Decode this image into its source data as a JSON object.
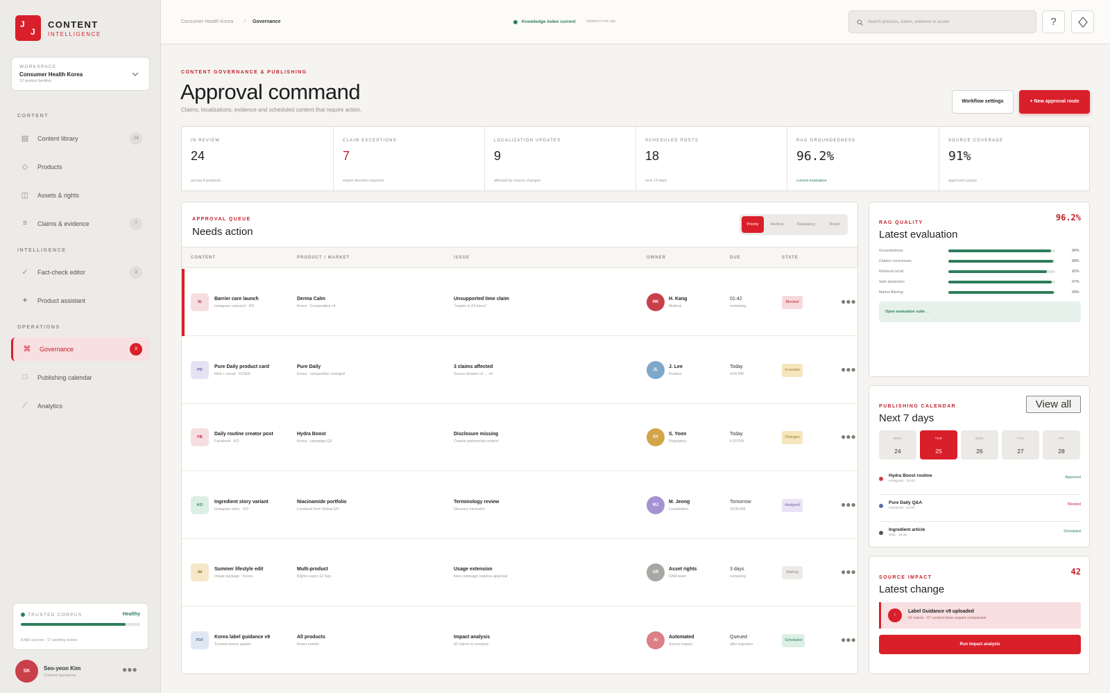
{
  "brand": {
    "logo_left": "J",
    "logo_right": "J",
    "name": "CONTENT",
    "subname": "INTELLIGENCE"
  },
  "workspace": {
    "caption": "WORKSPACE",
    "name": "Consumer Health Korea",
    "sub": "12 product families"
  },
  "sidebar": {
    "sections": [
      {
        "title": "CONTENT",
        "items": [
          {
            "label": "Content library",
            "icon": "library-icon",
            "count": "24"
          },
          {
            "label": "Products",
            "icon": "products-icon",
            "count": ""
          },
          {
            "label": "Assets & rights",
            "icon": "assets-icon",
            "count": ""
          },
          {
            "label": "Claims & evidence",
            "icon": "claims-icon",
            "count": "7"
          }
        ]
      },
      {
        "title": "INTELLIGENCE",
        "items": [
          {
            "label": "Fact-check editor",
            "icon": "check-icon",
            "count": "3"
          },
          {
            "label": "Product assistant",
            "icon": "sparkle-icon",
            "count": ""
          }
        ]
      },
      {
        "title": "OPERATIONS",
        "items": [
          {
            "label": "Governance",
            "icon": "command-icon",
            "count": "9",
            "active": true
          },
          {
            "label": "Publishing calendar",
            "icon": "calendar-icon",
            "count": ""
          },
          {
            "label": "Analytics",
            "icon": "analytics-icon",
            "count": ""
          }
        ]
      }
    ],
    "corpus": {
      "label": "TRUSTED CORPUS",
      "status": "Healthy",
      "progress": 0.88,
      "detail": "8,482 sources · 17 pending review"
    },
    "user": {
      "initials": "SK",
      "name": "Seo-yeon Kim",
      "role": "Content operations"
    }
  },
  "topbar": {
    "breadcrumb": [
      "Consumer Health Korea",
      "Governance"
    ],
    "status": "Knowledge index current",
    "updated": "Updated 4 min ago",
    "search_placeholder": "Search products, claims, evidence or assets"
  },
  "header": {
    "eyebrow": "CONTENT GOVERNANCE & PUBLISHING",
    "title": "Approval command",
    "subtitle": "Claims, localizations, evidence and scheduled content that require action.",
    "btn_settings": "Workflow settings",
    "btn_new": "+ New approval route"
  },
  "kpis": [
    {
      "label": "IN REVIEW",
      "value": "24",
      "sub": "across 8 products",
      "color": "#222222"
    },
    {
      "label": "CLAIM EXCEPTIONS",
      "value": "7",
      "sub": "expert decision required",
      "color": "#c3202c"
    },
    {
      "label": "LOCALIZATION UPDATES",
      "value": "9",
      "sub": "affected by source changes",
      "color": "#222222"
    },
    {
      "label": "SCHEDULED POSTS",
      "value": "18",
      "sub": "next 14 days",
      "color": "#222222"
    },
    {
      "label": "RAG GROUNDEDNESS",
      "value": "96.2%",
      "sub": "current evaluation",
      "color": "#222222"
    },
    {
      "label": "SOURCE COVERAGE",
      "value": "91%",
      "sub": "approved corpus",
      "color": "#222222"
    }
  ],
  "queue": {
    "eyebrow": "APPROVAL QUEUE",
    "title": "Needs action",
    "tabs": [
      "Priority",
      "Medical",
      "Regulatory",
      "Brand"
    ],
    "columns": [
      "CONTENT",
      "PRODUCT / MARKET",
      "ISSUE",
      "OWNER",
      "DUE",
      "STATE"
    ],
    "rows": [
      {
        "chip": "IG",
        "chip_bg": "#f6dde0",
        "chip_fg": "#c3202c",
        "title": "Barrier care launch",
        "sub": "Instagram carousel · KO",
        "product": "Derma Calm",
        "product_sub": "Korea · Composition v4",
        "issue": "Unsupported time claim",
        "issue_sub": "\"repairs in 24 hours\"",
        "owner_initials": "HK",
        "owner_color": "#c9404b",
        "owner": "H. Kang",
        "owner_role": "Medical",
        "due": "01:42",
        "due_sub": "remaining",
        "state": "Blocked",
        "state_bg": "#f7d9dc",
        "state_fg": "#c3202c",
        "selected": true
      },
      {
        "chip": "PD",
        "chip_bg": "#e5e3f3",
        "chip_fg": "#6a5fa8",
        "title": "Pure Daily product card",
        "sub": "Web + social · KO/EN",
        "product": "Pure Daily",
        "product_sub": "Korea · composition changed",
        "issue": "3 claims affected",
        "issue_sub": "Source dossier v3 → v4",
        "owner_initials": "JL",
        "owner_color": "#7fa7c9",
        "owner": "J. Lee",
        "owner_role": "Product",
        "due": "Today",
        "due_sub": "4:00 PM",
        "state": "In review",
        "state_bg": "#f6e6bd",
        "state_fg": "#9a7520",
        "selected": false
      },
      {
        "chip": "FB",
        "chip_bg": "#f6dde0",
        "chip_fg": "#c3202c",
        "title": "Daily routine creator post",
        "sub": "Facebook · KO",
        "product": "Hydra Boost",
        "product_sub": "Korea · campaign Q3",
        "issue": "Disclosure missing",
        "issue_sub": "Creator partnership context",
        "owner_initials": "SY",
        "owner_color": "#d2a54a",
        "owner": "S. Yoon",
        "owner_role": "Regulatory",
        "due": "Today",
        "due_sub": "5:30 PM",
        "state": "Changes",
        "state_bg": "#f6e6bd",
        "state_fg": "#9a7520",
        "selected": false
      },
      {
        "chip": "KO",
        "chip_bg": "#dcefe6",
        "chip_fg": "#2e7d5b",
        "title": "Ingredient story variant",
        "sub": "Instagram story · KO",
        "product": "Niacinamide portfolio",
        "product_sub": "Localized from Global EN",
        "issue": "Terminology review",
        "issue_sub": "Glossary mismatch",
        "owner_initials": "MJ",
        "owner_color": "#a393d0",
        "owner": "M. Jeong",
        "owner_role": "Localization",
        "due": "Tomorrow",
        "due_sub": "10:00 AM",
        "state": "Assigned",
        "state_bg": "#e9e3f5",
        "state_fg": "#6a5fa8",
        "selected": false
      },
      {
        "chip": "IM",
        "chip_bg": "#f5e7c8",
        "chip_fg": "#9a7520",
        "title": "Summer lifestyle edit",
        "sub": "Image package · Korea",
        "product": "Multi-product",
        "product_sub": "Rights expire 12 Sep",
        "issue": "Usage extension",
        "issue_sub": "New campaign requires approval",
        "owner_initials": "AR",
        "owner_color": "#a8a7a3",
        "owner": "Asset rights",
        "owner_role": "DAM team",
        "due": "3 days",
        "due_sub": "remaining",
        "state": "Waiting",
        "state_bg": "#eceae6",
        "state_fg": "#8d8c88",
        "selected": false
      },
      {
        "chip": "PDF",
        "chip_bg": "#dfe8f2",
        "chip_fg": "#5c7aa0",
        "title": "Korea label guidance v9",
        "sub": "Trusted source update",
        "product": "All products",
        "product_sub": "Korea market",
        "issue": "Impact analysis",
        "issue_sub": "42 claims to compare",
        "owner_initials": "AI",
        "owner_color": "#dc7f86",
        "owner": "Automated",
        "owner_role": "Source impact",
        "due": "Queued",
        "due_sub": "after ingestion",
        "state": "Scheduled",
        "state_bg": "#dcefe6",
        "state_fg": "#2e7d5b",
        "selected": false
      }
    ]
  },
  "rag": {
    "eyebrow": "RAG QUALITY",
    "title": "Latest evaluation",
    "score": "96.2%",
    "metrics": [
      {
        "label": "Groundedness",
        "value": 0.96,
        "pct": "96%"
      },
      {
        "label": "Citation correctness",
        "value": 0.98,
        "pct": "98%"
      },
      {
        "label": "Retrieval recall",
        "value": 0.92,
        "pct": "92%"
      },
      {
        "label": "Safe abstention",
        "value": 0.97,
        "pct": "97%"
      },
      {
        "label": "Market filtering",
        "value": 0.99,
        "pct": "99%"
      }
    ],
    "link": "Open evaluation suite →"
  },
  "calendar": {
    "eyebrow": "PUBLISHING CALENDAR",
    "title": "Next 7 days",
    "view_all": "View all",
    "days": [
      {
        "name": "MON",
        "date": "24",
        "active": false
      },
      {
        "name": "TUE",
        "date": "25",
        "active": true
      },
      {
        "name": "WED",
        "date": "26",
        "active": false
      },
      {
        "name": "THU",
        "date": "27",
        "active": false
      },
      {
        "name": "FRI",
        "date": "28",
        "active": false
      }
    ],
    "events": [
      {
        "title": "Hydra Boost routine",
        "sub": "Instagram · 10:00",
        "status": "Approved",
        "dot": "#c9404b",
        "color": "#2e7d5b"
      },
      {
        "title": "Pure Daily Q&A",
        "sub": "Facebook · 14:00",
        "status": "Blocked",
        "dot": "#5c6aa8",
        "color": "#c3202c"
      },
      {
        "title": "Ingredient article",
        "sub": "Web · 16:30",
        "status": "Scheduled",
        "dot": "#555555",
        "color": "#2e7d5b"
      }
    ]
  },
  "impact": {
    "eyebrow": "SOURCE IMPACT",
    "title": "Latest change",
    "count": "42",
    "alert_title": "Label Guidance v9 uploaded",
    "alert_sub": "42 claims · 67 content items require comparison",
    "alert_icon": "!",
    "button": "Run impact analysis"
  }
}
